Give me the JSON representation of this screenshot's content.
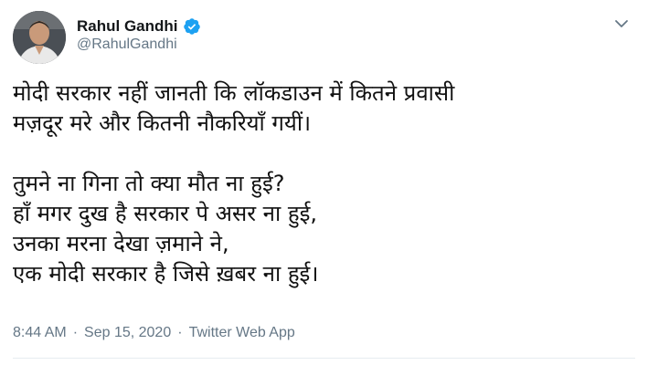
{
  "author": {
    "display_name": "Rahul Gandhi",
    "handle": "@RahulGandhi",
    "verified": true,
    "avatar_icon": "profile-photo"
  },
  "tweet": {
    "lines": [
      "मोदी सरकार नहीं जानती कि लॉकडाउन में कितने प्रवासी",
      "मज़दूर मरे और कितनी नौकरियाँ गयीं।",
      "तुमने ना गिना तो क्या मौत ना हुई?",
      "हाँ मगर दुख है सरकार पे असर ना हुई,",
      "उनका मरना देखा ज़माने ने,",
      "एक मोदी सरकार है जिसे ख़बर ना हुई।"
    ]
  },
  "meta": {
    "time": "8:44 AM",
    "separator": "·",
    "date": "Sep 15, 2020",
    "source": "Twitter Web App"
  },
  "colors": {
    "verified_badge": "#1da1f2",
    "muted_text": "#657786",
    "primary_text": "#14171a"
  },
  "icons": {
    "verified": "verified-badge-icon",
    "menu": "chevron-down-icon"
  }
}
